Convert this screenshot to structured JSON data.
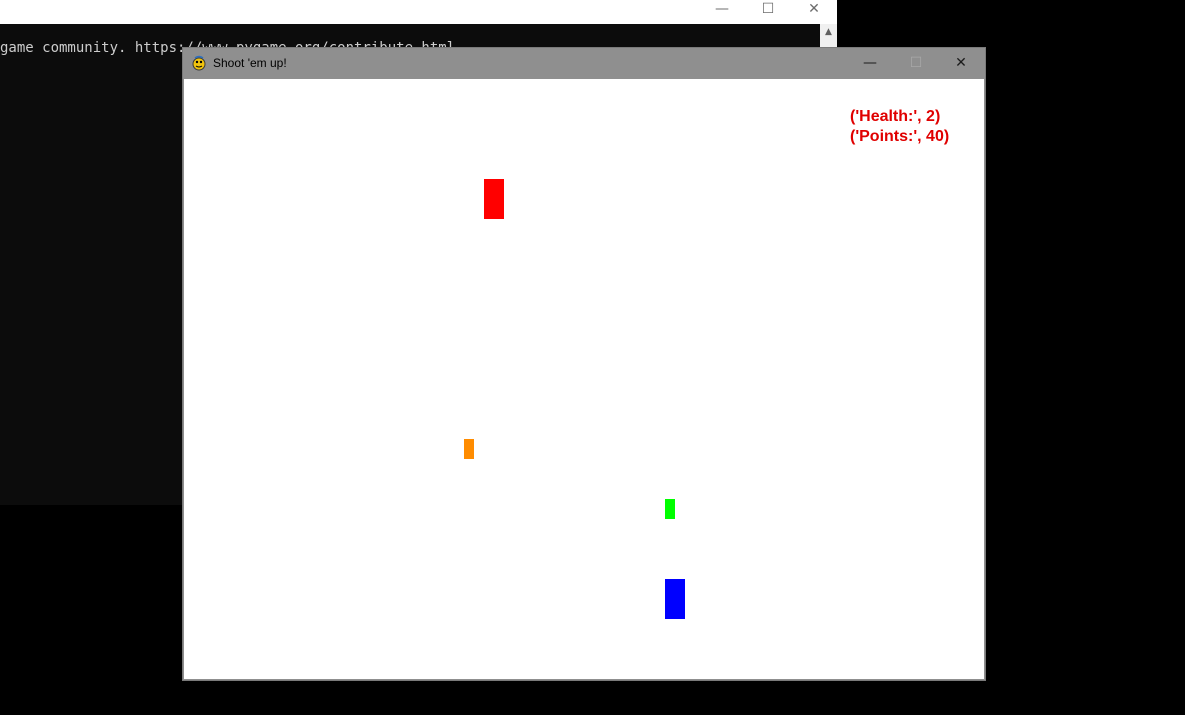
{
  "console": {
    "text": "game community. https://www.pygame.org/contribute.html",
    "controls": {
      "minimize": "—",
      "maximize": "☐",
      "close": "✕"
    },
    "scroll_up_icon": "▲"
  },
  "game_window": {
    "title": "Shoot 'em up!",
    "app_icon": "pygame-snake-icon",
    "controls": {
      "minimize": "—",
      "maximize": "☐",
      "close": "✕"
    }
  },
  "hud": {
    "health_text": "('Health:', 2)",
    "points_text": "('Points:', 40)",
    "health": 2,
    "points": 40,
    "color": "#e00000"
  },
  "sprites": {
    "enemy": {
      "color": "#ff0000"
    },
    "enemy_bullet": {
      "color": "#ff8c00"
    },
    "player_bullet": {
      "color": "#00ff00"
    },
    "player": {
      "color": "#0000ff"
    }
  }
}
